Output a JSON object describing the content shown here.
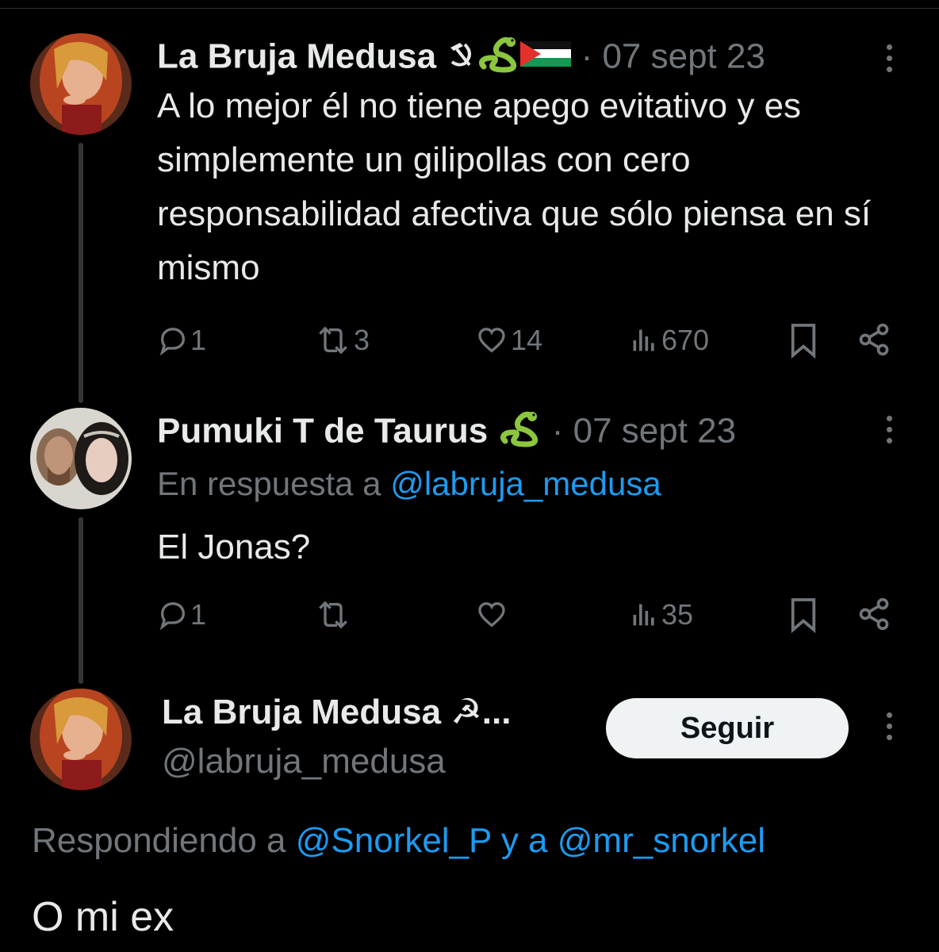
{
  "tweet1": {
    "name": "La Bruja Medusa",
    "meta": " · 07 sept 23",
    "text": "A lo mejor él no tiene apego evitativo y es simplemente un gilipollas con cero responsabilidad afectiva que sólo piensa en sí mismo",
    "replies": "1",
    "retweets": "3",
    "likes": "14",
    "views": "670"
  },
  "tweet2": {
    "name": "Pumuki T de Taurus",
    "meta": " · 07 sept 23",
    "reply_prefix": "En respuesta a ",
    "reply_handle": "@labruja_medusa",
    "text": "El Jonas?",
    "replies": "1",
    "retweets": "",
    "likes": "",
    "views": "35"
  },
  "main": {
    "name": "La Bruja Medusa ☭...",
    "handle": "@labruja_medusa",
    "follow_label": "Seguir",
    "responding_prefix": "Respondiendo a ",
    "responding_handle1": "@Snorkel_P",
    "responding_and": " y a ",
    "responding_handle2": "@mr_snorkel",
    "text": "O mi ex"
  },
  "colors": {
    "background": "#000000",
    "text": "#e7e9ea",
    "muted": "#71767b",
    "link": "#1d9bf0",
    "follow_bg": "#eff3f4"
  },
  "icons": [
    "more-icon",
    "reply-icon",
    "retweet-icon",
    "like-icon",
    "views-icon",
    "bookmark-icon",
    "share-icon",
    "hammer-sickle-icon",
    "snake-icon",
    "palestine-flag-icon"
  ]
}
